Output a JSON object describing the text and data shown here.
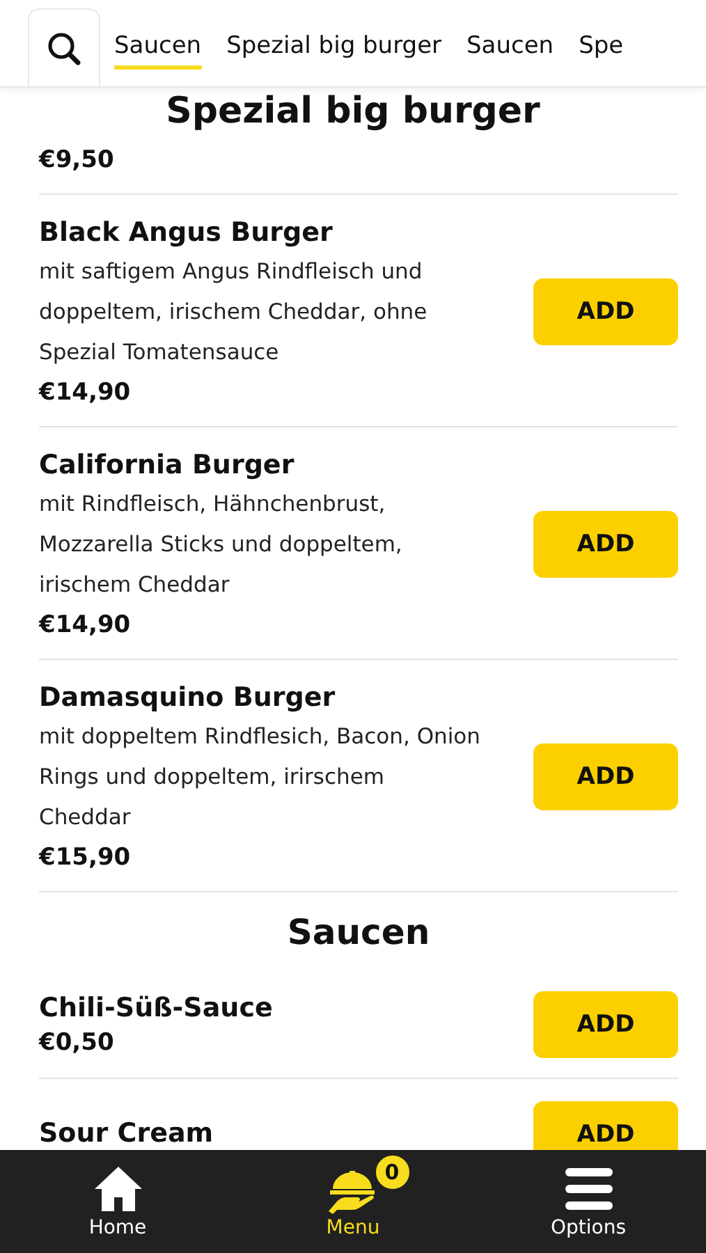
{
  "tabs": [
    {
      "label": "Saucen",
      "selected": true
    },
    {
      "label": "Spezial big burger",
      "selected": false
    },
    {
      "label": "Saucen",
      "selected": false
    },
    {
      "label": "Spe",
      "selected": false
    }
  ],
  "sticky_heading": "Spezial big burger",
  "list": [
    {
      "kind": "item",
      "price": "€9,50"
    },
    {
      "kind": "item",
      "name": "Black Angus Burger",
      "description": "mit saftigem Angus Rindfleisch und doppeltem, irischem Cheddar, ohne Spezial Tomatensauce",
      "price": "€14,90",
      "button": "ADD"
    },
    {
      "kind": "item",
      "name": "California Burger",
      "description": "mit Rindfleisch, Hähnchenbrust, Mozzarella Sticks und doppeltem, irischem Cheddar",
      "price": "€14,90",
      "button": "ADD"
    },
    {
      "kind": "item",
      "name": "Damasquino Burger",
      "description": "mit doppeltem Rindflesich, Bacon, Onion Rings und doppeltem, irirschem Cheddar",
      "price": "€15,90",
      "button": "ADD"
    },
    {
      "kind": "heading",
      "title": "Saucen"
    },
    {
      "kind": "item",
      "name": "Chili-Süß-Sauce",
      "price": "€0,50",
      "button": "ADD"
    },
    {
      "kind": "item",
      "name": "Sour Cream",
      "button": "ADD"
    }
  ],
  "nav": [
    {
      "label": "Home",
      "kind": "home",
      "selected": false
    },
    {
      "label": "Menu",
      "kind": "cloche",
      "selected": true,
      "badge": "0"
    },
    {
      "label": "Options",
      "kind": "menu",
      "selected": false
    }
  ]
}
